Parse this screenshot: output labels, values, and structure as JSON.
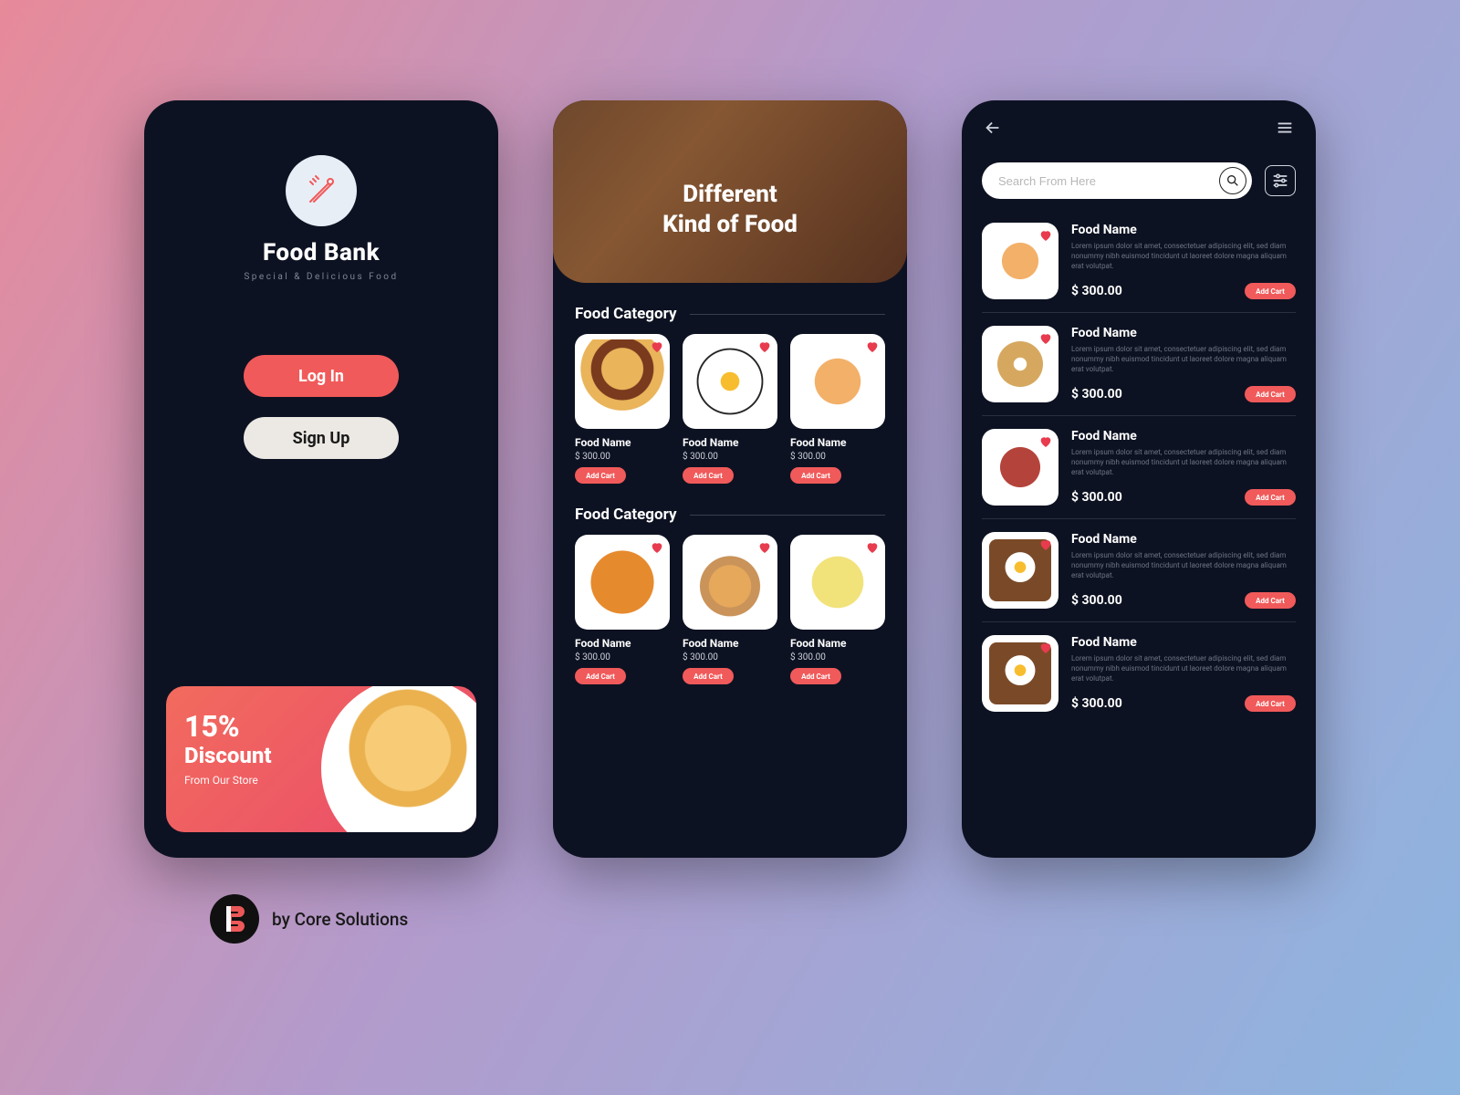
{
  "screen1": {
    "brand": "Food Bank",
    "tagline": "Special & Delicious Food",
    "login": "Log In",
    "signup": "Sign Up",
    "promo": {
      "percent": "15%",
      "discount": "Discount",
      "from": "From Our Store"
    }
  },
  "screen2": {
    "hero_line1": "Different",
    "hero_line2": "Kind of Food",
    "section_a": "Food Category",
    "section_b": "Food Category",
    "cards_a": [
      {
        "name": "Food Name",
        "price": "$ 300.00",
        "btn": "Add Cart"
      },
      {
        "name": "Food Name",
        "price": "$ 300.00",
        "btn": "Add Cart"
      },
      {
        "name": "Food Name",
        "price": "$ 300.00",
        "btn": "Add Cart"
      }
    ],
    "cards_b": [
      {
        "name": "Food Name",
        "price": "$ 300.00",
        "btn": "Add Cart"
      },
      {
        "name": "Food Name",
        "price": "$ 300.00",
        "btn": "Add Cart"
      },
      {
        "name": "Food Name",
        "price": "$ 300.00",
        "btn": "Add Cart"
      }
    ]
  },
  "screen3": {
    "search_placeholder": "Search From Here",
    "items": [
      {
        "name": "Food Name",
        "desc": "Lorem ipsum dolor sit amet, consectetuer adipiscing elit, sed diam nonummy nibh euismod tincidunt ut laoreet dolore magna aliquam erat volutpat.",
        "price": "$ 300.00",
        "btn": "Add Cart"
      },
      {
        "name": "Food Name",
        "desc": "Lorem ipsum dolor sit amet, consectetuer adipiscing elit, sed diam nonummy nibh euismod tincidunt ut laoreet dolore magna aliquam erat volutpat.",
        "price": "$ 300.00",
        "btn": "Add Cart"
      },
      {
        "name": "Food Name",
        "desc": "Lorem ipsum dolor sit amet, consectetuer adipiscing elit, sed diam nonummy nibh euismod tincidunt ut laoreet dolore magna aliquam erat volutpat.",
        "price": "$ 300.00",
        "btn": "Add Cart"
      },
      {
        "name": "Food Name",
        "desc": "Lorem ipsum dolor sit amet, consectetuer adipiscing elit, sed diam nonummy nibh euismod tincidunt ut laoreet dolore magna aliquam erat volutpat.",
        "price": "$ 300.00",
        "btn": "Add Cart"
      },
      {
        "name": "Food Name",
        "desc": "Lorem ipsum dolor sit amet, consectetuer adipiscing elit, sed diam nonummy nibh euismod tincidunt ut laoreet dolore magna aliquam erat volutpat.",
        "price": "$ 300.00",
        "btn": "Add Cart"
      }
    ]
  },
  "footer": {
    "by": "by Core Solutions"
  },
  "colors": {
    "accent": "#f15a5a",
    "bg": "#0d1222"
  }
}
